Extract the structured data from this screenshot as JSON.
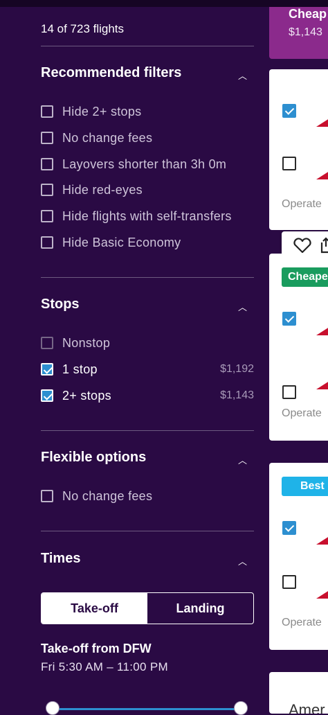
{
  "results_count": "14 of 723 flights",
  "sections": {
    "recommended": {
      "title": "Recommended filters",
      "items": [
        {
          "label": "Hide 2+ stops",
          "checked": false
        },
        {
          "label": "No change fees",
          "checked": false
        },
        {
          "label": "Layovers shorter than 3h 0m",
          "checked": false
        },
        {
          "label": "Hide red-eyes",
          "checked": false
        },
        {
          "label": "Hide flights with self-transfers",
          "checked": false
        },
        {
          "label": "Hide Basic Economy",
          "checked": false
        }
      ]
    },
    "stops": {
      "title": "Stops",
      "items": [
        {
          "label": "Nonstop",
          "checked": false,
          "price": ""
        },
        {
          "label": "1 stop",
          "checked": true,
          "price": "$1,192"
        },
        {
          "label": "2+ stops",
          "checked": true,
          "price": "$1,143"
        }
      ]
    },
    "flexible": {
      "title": "Flexible options",
      "items": [
        {
          "label": "No change fees",
          "checked": false
        }
      ]
    },
    "times": {
      "title": "Times",
      "tabs": [
        "Take-off",
        "Landing"
      ],
      "active_tab": "Take-off",
      "takeoff_title": "Take-off from DFW",
      "takeoff_range": "Fri 5:30 AM – 11:00 PM",
      "slider_range_fraction": [
        0.0,
        1.0
      ]
    }
  },
  "results": {
    "promo": {
      "title": "Cheap",
      "price": "$1,143"
    },
    "cards": [
      {
        "badge": "",
        "operated": "Operate"
      },
      {
        "badge": "Cheape",
        "badge_color": "#1a9c5e",
        "operated": "Operate"
      },
      {
        "badge": "Best",
        "badge_color": "#1fb3e8",
        "operated": "Operate"
      },
      {
        "badge": "",
        "operated": "",
        "text": "Amer"
      }
    ]
  },
  "colors": {
    "background": "#2a0a44",
    "accent_blue": "#2d8fd0",
    "promo_purple": "#8b2a8c",
    "airline_red": "#c8102e"
  }
}
